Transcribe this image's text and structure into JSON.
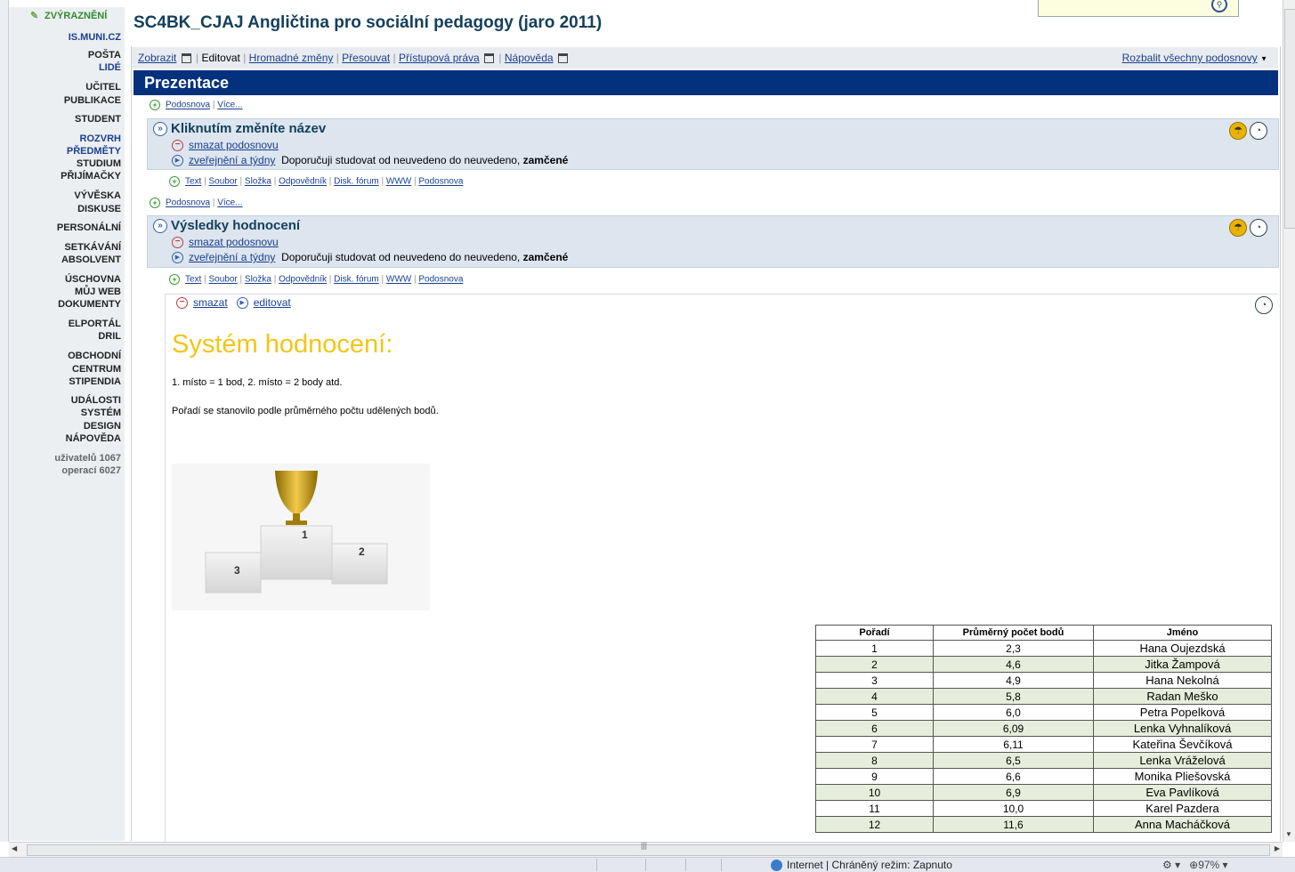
{
  "nav": {
    "highlight": "ZVÝRAZNĚNÍ",
    "logo": "IS.MUNI.CZ",
    "items": [
      "POŠTA",
      "LIDÉ",
      "UČITEL",
      "PUBLIKACE",
      "STUDENT",
      "ROZVRH",
      "PŘEDMĚTY",
      "STUDIUM",
      "PŘIJÍMAČKY",
      "VÝVĚSKA",
      "DISKUSE",
      "PERSONÁLNÍ",
      "SETKÁVÁNÍ",
      "ABSOLVENT",
      "ÚSCHOVNA",
      "MŮJ WEB",
      "DOKUMENTY",
      "ELPORTÁL",
      "DRIL",
      "OBCHODNÍ",
      "CENTRUM",
      "STIPENDIA",
      "UDÁLOSTI",
      "SYSTÉM",
      "DESIGN",
      "NÁPOVĚDA"
    ],
    "stats": [
      "uživatelů 1067",
      "operací 6027"
    ]
  },
  "page": {
    "title": "SC4BK_CJAJ Angličtina pro sociální pedagogy (jaro 2011)"
  },
  "menu": {
    "zobrazit": "Zobrazit",
    "editovat": "Editovat",
    "hromadne": "Hromadné změny",
    "presouvat": "Přesouvat",
    "prava": "Přístupová práva",
    "napoveda": "Nápověda",
    "expand": "Rozbalit všechny podosnovy"
  },
  "section": {
    "title": "Prezentace"
  },
  "rowlinks": {
    "podosnova": "Podosnova",
    "vice": "Více..."
  },
  "addlinks": [
    "Text",
    "Soubor",
    "Složka",
    "Odpovědník",
    "Disk. fórum",
    "WWW",
    "Podosnova"
  ],
  "sub1": {
    "title": "Kliknutím změníte název",
    "delete": "smazat podosnovu",
    "weeks": "zveřejnění a týdny",
    "recommend": "Doporučuji studovat od neuvedeno do neuvedeno,",
    "locked": "zamčené"
  },
  "sub2": {
    "title": "Výsledky hodnocení",
    "delete": "smazat podosnovu",
    "weeks": "zveřejnění a týdny",
    "recommend": "Doporučuji studovat od neuvedeno do neuvedeno,",
    "locked": "zamčené"
  },
  "content": {
    "delete": "smazat",
    "edit": "editovat",
    "heading": "Systém hodnocení:",
    "p1": "1. místo = 1 bod, 2. místo = 2 body atd.",
    "p2": "Pořadí se stanovilo podle průměrného počtu udělených bodů.",
    "podium_labels": [
      "1",
      "2",
      "3"
    ]
  },
  "ranking": {
    "headers": [
      "Pořadí",
      "Průměrný počet bodů",
      "Jméno"
    ],
    "rows": [
      [
        "1",
        "2,3",
        "Hana Oujezdská"
      ],
      [
        "2",
        "4,6",
        "Jitka Žampová"
      ],
      [
        "3",
        "4,9",
        "Hana Nekolná"
      ],
      [
        "4",
        "5,8",
        "Radan Meško"
      ],
      [
        "5",
        "6,0",
        "Petra Popelková"
      ],
      [
        "6",
        "6,09",
        "Lenka Vyhnalíková"
      ],
      [
        "7",
        "6,11",
        "Kateřina Ševčíková"
      ],
      [
        "8",
        "6,5",
        "Lenka Vráželová"
      ],
      [
        "9",
        "6,6",
        "Monika Pliešovská"
      ],
      [
        "10",
        "6,9",
        "Eva Pavlíková"
      ],
      [
        "11",
        "10,0",
        "Karel Pazdera"
      ],
      [
        "12",
        "11,6",
        "Anna Macháčková"
      ]
    ]
  },
  "status": {
    "zone": "Internet | Chráněný režim: Zapnuto",
    "zoom": "97%"
  },
  "colors": {
    "header_bg": "#03317e",
    "title": "#14405c",
    "link": "#1a3f8f",
    "heading_yellow": "#f3c514",
    "table_green": "#e6eedb",
    "subbox_bg": "#dde5ef"
  }
}
